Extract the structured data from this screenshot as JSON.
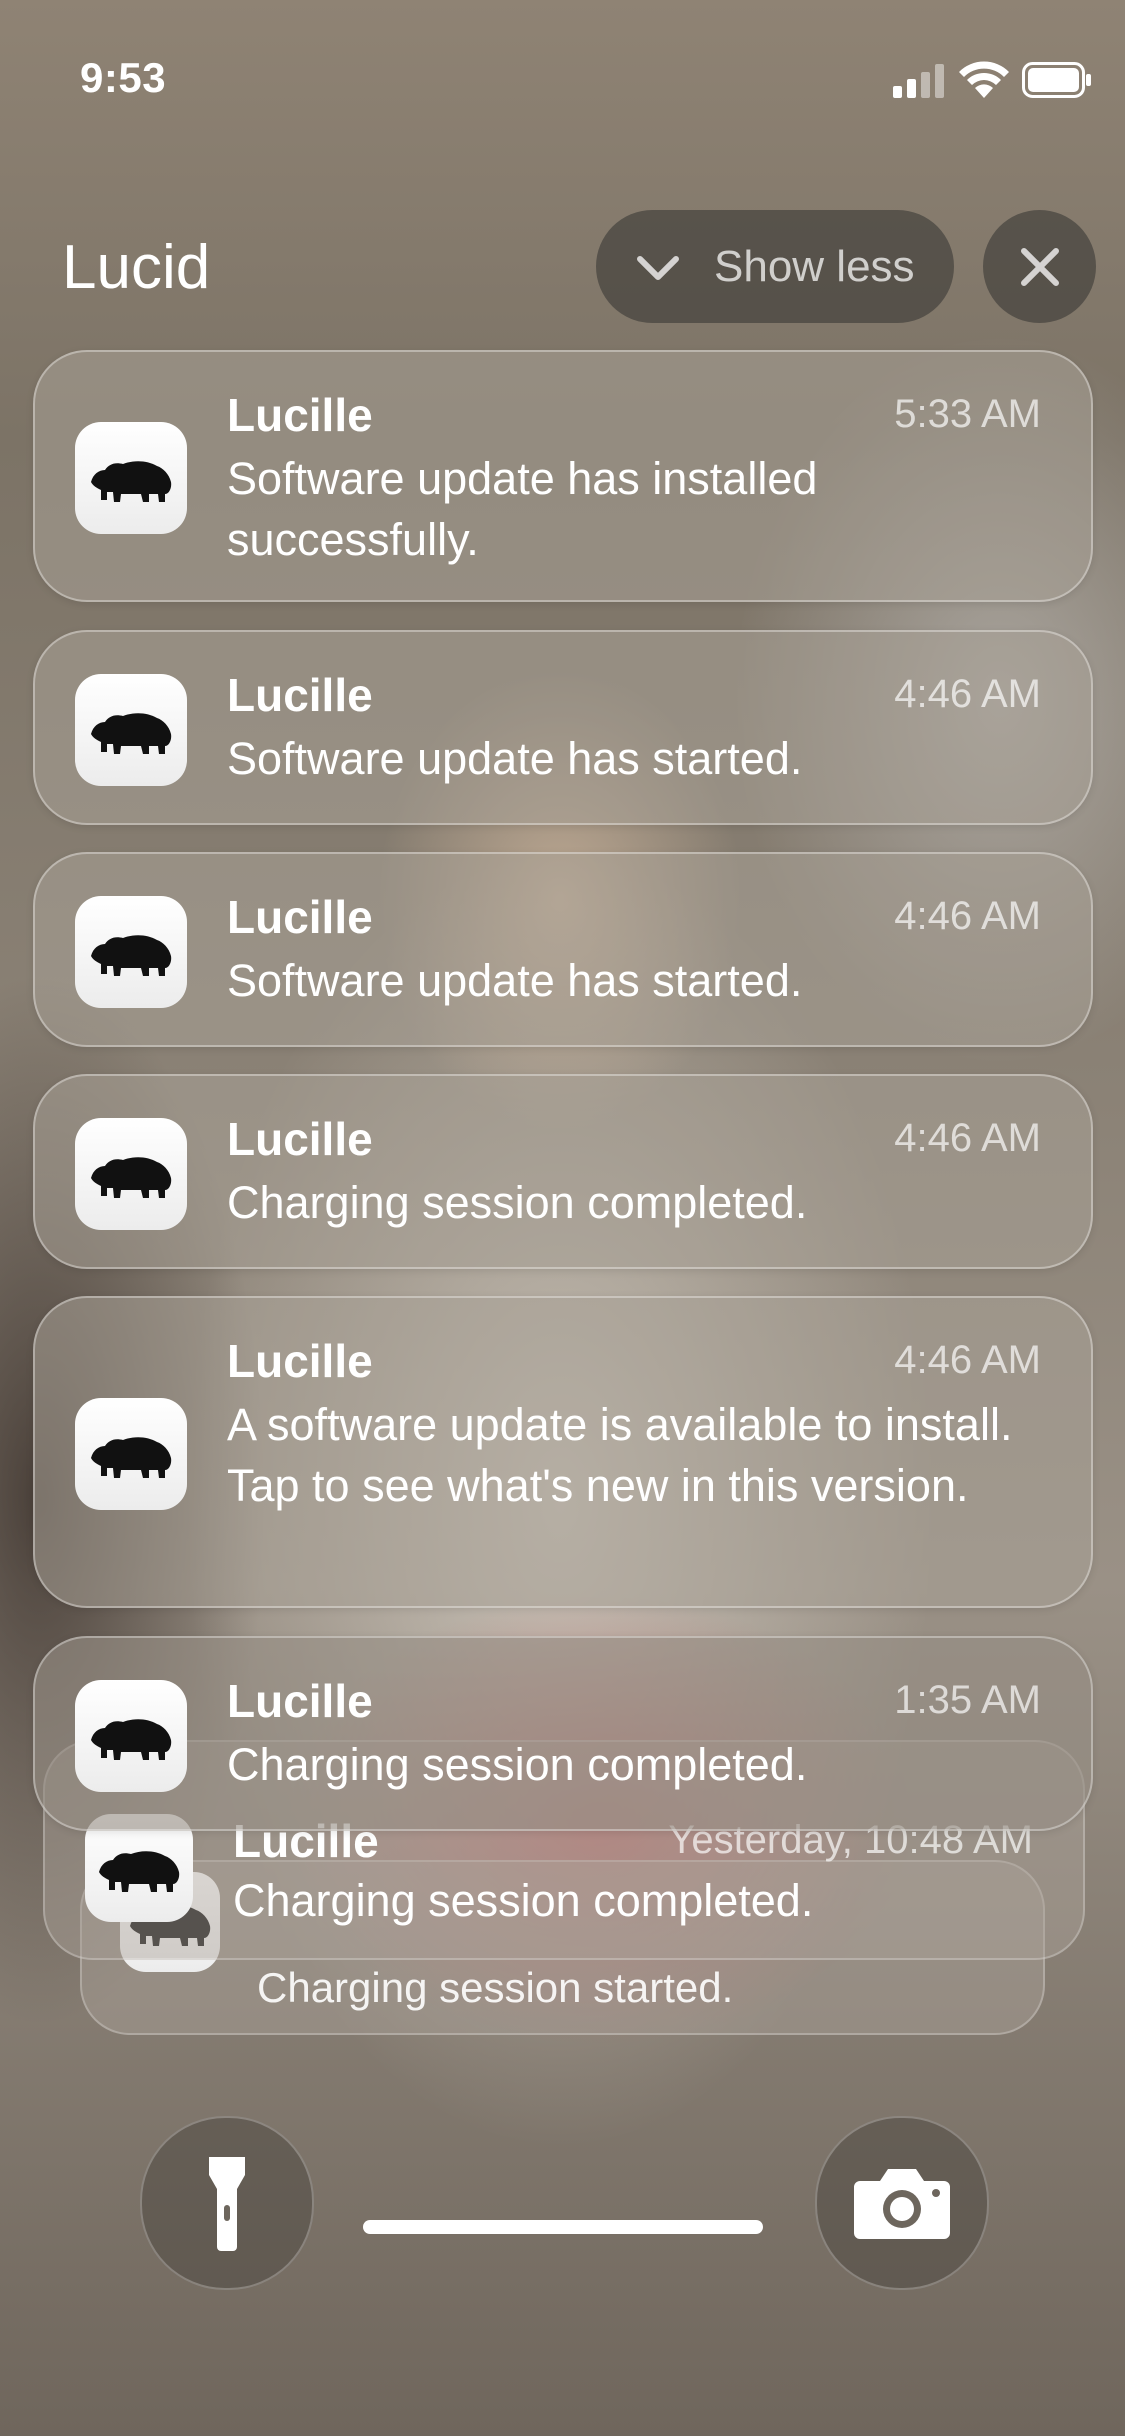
{
  "status_bar": {
    "time": "9:53",
    "icons": [
      "cellular-signal-icon",
      "wifi-icon",
      "battery-icon"
    ]
  },
  "group": {
    "title": "Lucid",
    "show_less_label": "Show less",
    "close_icon": "close-icon"
  },
  "notifications": [
    {
      "app": "Lucille",
      "time": "5:33 AM",
      "body": "Software update has installed successfully."
    },
    {
      "app": "Lucille",
      "time": "4:46 AM",
      "body": "Software update has started."
    },
    {
      "app": "Lucille",
      "time": "4:46 AM",
      "body": "Software update has started."
    },
    {
      "app": "Lucille",
      "time": "4:46 AM",
      "body": "Charging session completed."
    },
    {
      "app": "Lucille",
      "time": "4:46 AM",
      "body": "A software update is available to install. Tap to see what's new in this version."
    },
    {
      "app": "Lucille",
      "time": "1:35 AM",
      "body": "Charging session completed."
    }
  ],
  "stacked": [
    {
      "app": "Lucille",
      "time": "Yesterday, 10:48 AM",
      "body": "Charging session completed."
    },
    {
      "body": "Charging session started."
    }
  ],
  "lock_screen": {
    "left_icon": "flashlight-icon",
    "right_icon": "camera-icon"
  }
}
